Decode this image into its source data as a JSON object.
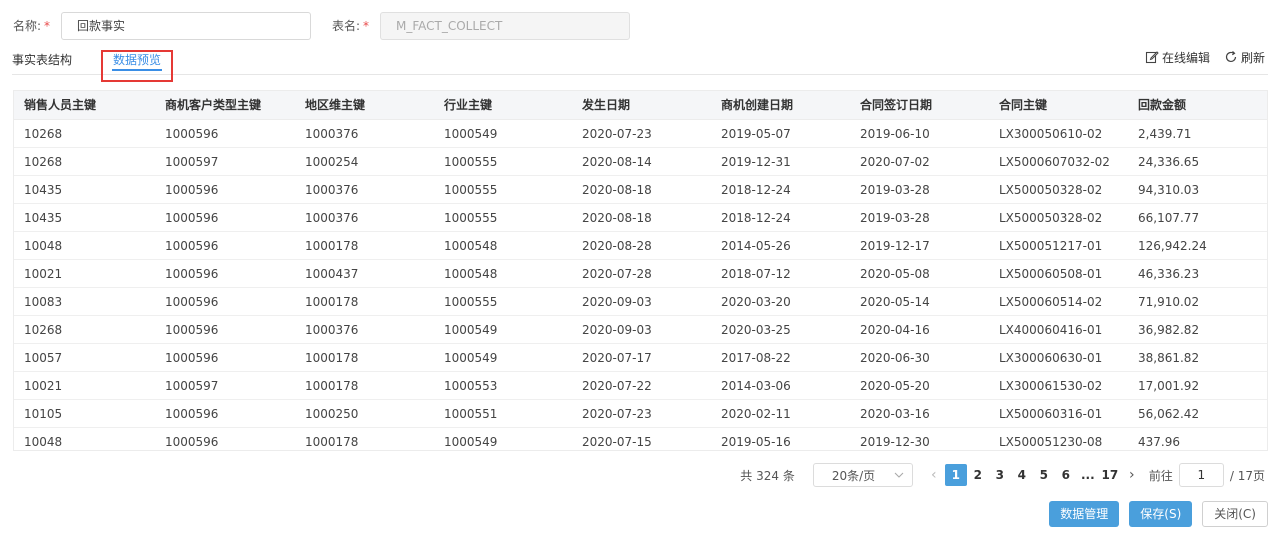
{
  "form": {
    "name_label": "名称:",
    "name_required": "*",
    "name_value": "回款事实",
    "table_label": "表名:",
    "table_required": "*",
    "table_value": "M_FACT_COLLECT"
  },
  "tabs": [
    {
      "label": "事实表结构",
      "active": false
    },
    {
      "label": "数据预览",
      "active": true
    }
  ],
  "toolbar": {
    "edit_online_label": "在线编辑",
    "refresh_label": "刷新",
    "edit_icon": "edit-icon",
    "refresh_icon": "refresh-icon"
  },
  "table": {
    "columns": [
      "销售人员主键",
      "商机客户类型主键",
      "地区维主键",
      "行业主键",
      "发生日期",
      "商机创建日期",
      "合同签订日期",
      "合同主键",
      "回款金额"
    ],
    "rows": [
      [
        "10268",
        "1000596",
        "1000376",
        "1000549",
        "2020-07-23",
        "2019-05-07",
        "2019-06-10",
        "LX300050610-02",
        "2,439.71"
      ],
      [
        "10268",
        "1000597",
        "1000254",
        "1000555",
        "2020-08-14",
        "2019-12-31",
        "2020-07-02",
        "LX5000607032-02",
        "24,336.65"
      ],
      [
        "10435",
        "1000596",
        "1000376",
        "1000555",
        "2020-08-18",
        "2018-12-24",
        "2019-03-28",
        "LX500050328-02",
        "94,310.03"
      ],
      [
        "10435",
        "1000596",
        "1000376",
        "1000555",
        "2020-08-18",
        "2018-12-24",
        "2019-03-28",
        "LX500050328-02",
        "66,107.77"
      ],
      [
        "10048",
        "1000596",
        "1000178",
        "1000548",
        "2020-08-28",
        "2014-05-26",
        "2019-12-17",
        "LX500051217-01",
        "126,942.24"
      ],
      [
        "10021",
        "1000596",
        "1000437",
        "1000548",
        "2020-07-28",
        "2018-07-12",
        "2020-05-08",
        "LX500060508-01",
        "46,336.23"
      ],
      [
        "10083",
        "1000596",
        "1000178",
        "1000555",
        "2020-09-03",
        "2020-03-20",
        "2020-05-14",
        "LX500060514-02",
        "71,910.02"
      ],
      [
        "10268",
        "1000596",
        "1000376",
        "1000549",
        "2020-09-03",
        "2020-03-25",
        "2020-04-16",
        "LX400060416-01",
        "36,982.82"
      ],
      [
        "10057",
        "1000596",
        "1000178",
        "1000549",
        "2020-07-17",
        "2017-08-22",
        "2020-06-30",
        "LX300060630-01",
        "38,861.82"
      ],
      [
        "10021",
        "1000597",
        "1000178",
        "1000553",
        "2020-07-22",
        "2014-03-06",
        "2020-05-20",
        "LX300061530-02",
        "17,001.92"
      ],
      [
        "10105",
        "1000596",
        "1000250",
        "1000551",
        "2020-07-23",
        "2020-02-11",
        "2020-03-16",
        "LX500060316-01",
        "56,062.42"
      ],
      [
        "10048",
        "1000596",
        "1000178",
        "1000549",
        "2020-07-15",
        "2019-05-16",
        "2019-12-30",
        "LX500051230-08",
        "437.96"
      ]
    ]
  },
  "pagination": {
    "total_text": "共 324 条",
    "page_size": "20条/页",
    "pages": [
      "1",
      "2",
      "3",
      "4",
      "5",
      "6",
      "...",
      "17"
    ],
    "current_page": "1",
    "goto_label": "前往",
    "goto_value": "1",
    "total_pages_text": "/ 17页"
  },
  "footer": {
    "data_manage_label": "数据管理",
    "save_label": "保存(S)",
    "close_label": "关闭(C)"
  },
  "colors": {
    "accent": "#3a8ee6",
    "primary_button": "#4a9fdc",
    "highlight_box": "#e53935",
    "required": "#e94b4b"
  }
}
